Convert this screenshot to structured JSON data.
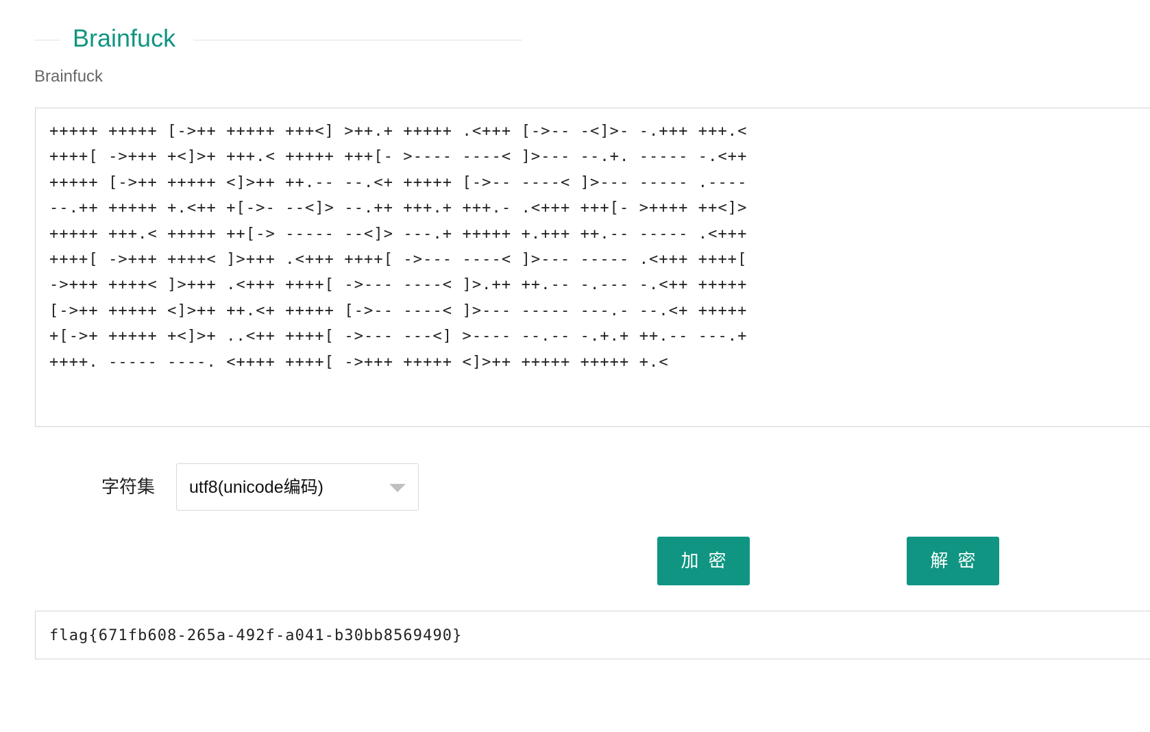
{
  "header": {
    "title": "Brainfuck",
    "subtitle": "Brainfuck"
  },
  "input": {
    "lines": [
      "+++++ +++++ [->++ +++++ +++<] >++.+ +++++ .<+++ [->-- -<]>- -.+++ +++.<",
      "++++[ ->+++ +<]>+ +++.< +++++ +++[- >---- ----< ]>--- --.+. ----- -.<++",
      "+++++ [->++ +++++ <]>++ ++.-- --.<+ +++++ [->-- ----< ]>--- ----- .----",
      "--.++ +++++ +.<++ +[->- --<]> --.++ +++.+ +++.- .<+++ +++[- >++++ ++<]>",
      "+++++ +++.< +++++ ++[-> ----- --<]> ---.+ +++++ +.+++ ++.-- ----- .<+++",
      "++++[ ->+++ ++++< ]>+++ .<+++ ++++[ ->--- ----< ]>--- ----- .<+++ ++++[",
      "->+++ ++++< ]>+++ .<+++ ++++[ ->--- ----< ]>.++ ++.-- -.--- -.<++ +++++",
      "[->++ +++++ <]>++ ++.<+ +++++ [->-- ----< ]>--- ----- ---.- --.<+ +++++",
      "+[->+ +++++ +<]>+ ..<++ ++++[ ->--- ---<] >---- --.-- -.+.+ ++.-- ---.+",
      "++++. ----- ----. <++++ ++++[ ->+++ +++++ <]>++ +++++ +++++ +.<"
    ]
  },
  "charset": {
    "label": "字符集",
    "selected": "utf8(unicode编码)"
  },
  "buttons": {
    "encrypt": "加密",
    "decrypt": "解密"
  },
  "output": {
    "value": "flag{671fb608-265a-492f-a041-b30bb8569490}"
  },
  "colors": {
    "accent": "#0f9582"
  }
}
